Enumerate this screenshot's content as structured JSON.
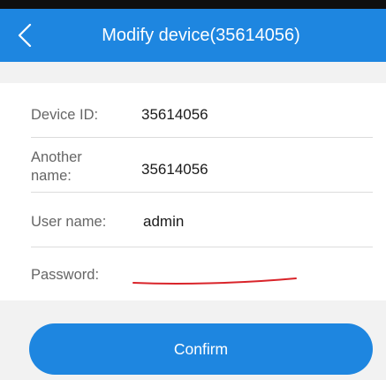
{
  "header": {
    "title": "Modify device(35614056)",
    "back_icon": "chevron-left-icon"
  },
  "form": {
    "device_id": {
      "label": "Device ID:",
      "value": "35614056"
    },
    "another_name": {
      "label": "Another name:",
      "value": "35614056"
    },
    "user_name": {
      "label": "User name:",
      "value": "admin"
    },
    "password": {
      "label": "Password:",
      "value": ""
    }
  },
  "actions": {
    "confirm_label": "Confirm"
  },
  "colors": {
    "accent": "#1e86e0",
    "annotation": "#d9242a"
  }
}
